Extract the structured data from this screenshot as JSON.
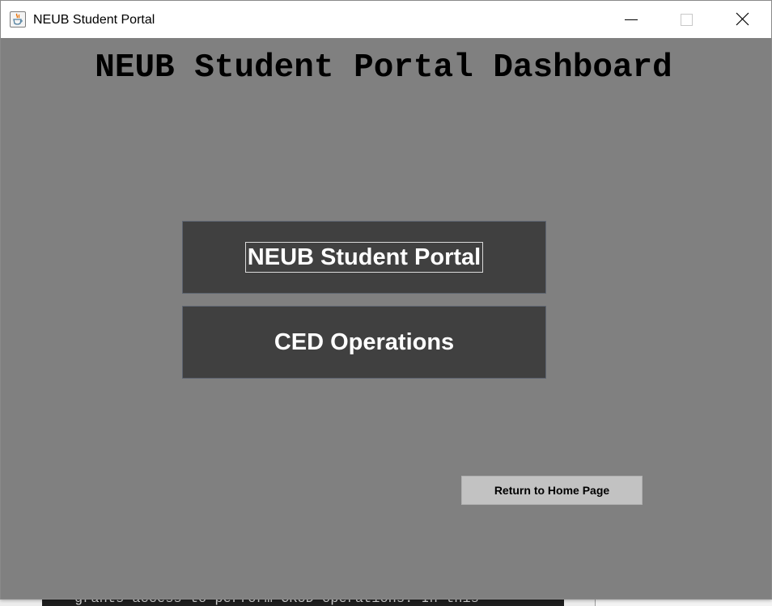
{
  "window": {
    "title": "NEUB Student Portal",
    "icon": "java-coffee-icon",
    "controls": [
      "minimize-icon",
      "maximize-icon",
      "close-icon"
    ]
  },
  "dashboard": {
    "heading": "NEUB Student Portal Dashboard",
    "buttons": {
      "student_portal": "NEUB Student Portal",
      "ced_operations": "CED Operations",
      "return_home": "Return to Home Page"
    }
  },
  "background": {
    "terminal_text": "grants access to perform CRUD operations. In this"
  },
  "colors": {
    "content_background": "#808080",
    "primary_button": "#404040",
    "primary_button_text": "#ffffff",
    "secondary_button": "#c2c2c2"
  }
}
